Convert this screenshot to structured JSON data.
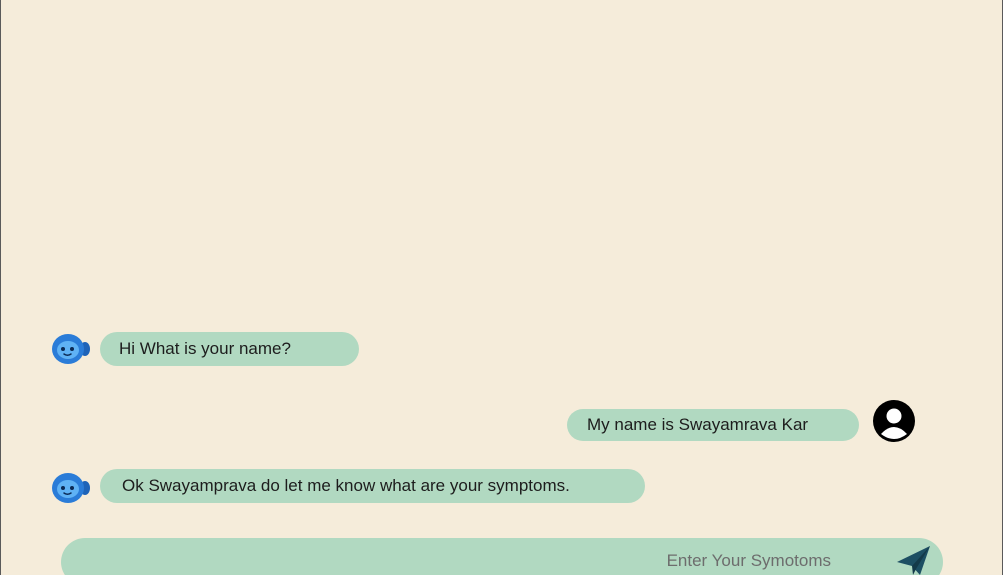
{
  "messages": [
    {
      "sender": "bot",
      "text": "Hi What is your name?",
      "avatar_icon": "robot-icon"
    },
    {
      "sender": "user",
      "text": "My name is Swayamrava Kar",
      "avatar_icon": "user-icon"
    },
    {
      "sender": "bot",
      "text": "Ok Swayamprava do let me know what are your symptoms.",
      "avatar_icon": "robot-icon"
    }
  ],
  "composer": {
    "placeholder": "Enter Your Symotoms",
    "value": "",
    "send_icon": "paper-plane-icon"
  },
  "colors": {
    "background": "#f5ecda",
    "bubble": "#b1d9c1",
    "robot_accent": "#2a7cd8",
    "send_icon": "#1d4f63",
    "user_icon": "#000000"
  }
}
